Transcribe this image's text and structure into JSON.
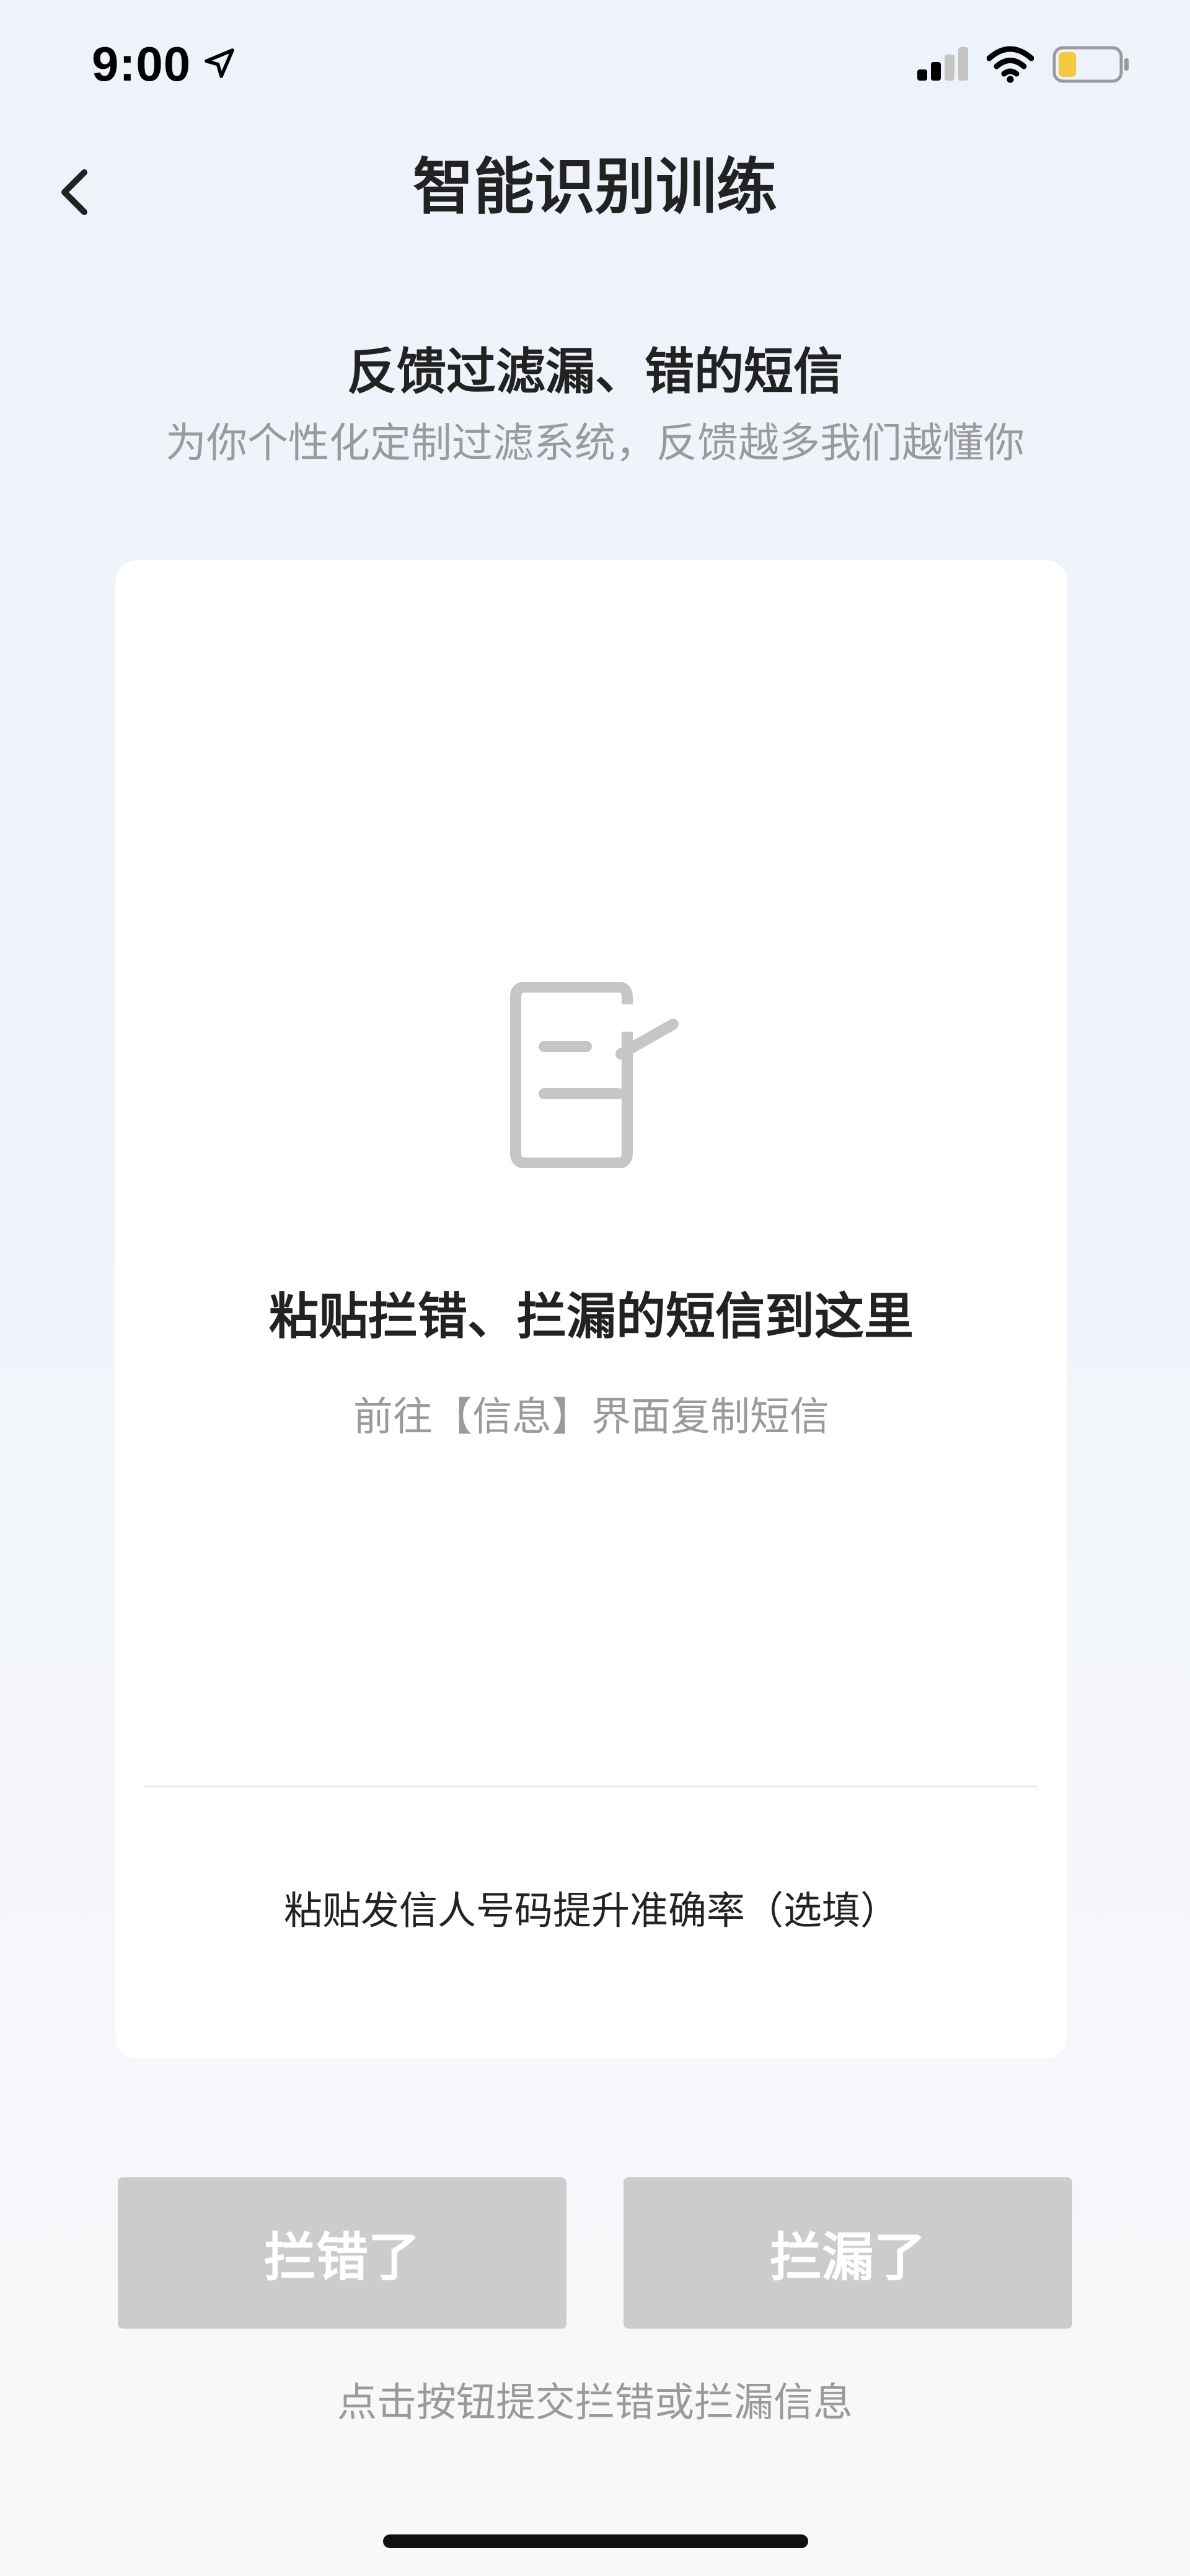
{
  "status_bar": {
    "time": "9:00",
    "icons": [
      "location-arrow-icon",
      "cellular-signal-icon",
      "wifi-icon",
      "battery-icon"
    ],
    "battery_level": 0.3,
    "battery_color": "#f5c842"
  },
  "nav": {
    "back_icon": "chevron-left-icon",
    "title": "智能识别训练"
  },
  "header": {
    "title": "反馈过滤漏、错的短信",
    "subtitle": "为你个性化定制过滤系统，反馈越多我们越懂你"
  },
  "card": {
    "icon": "note-edit-icon",
    "paste_title": "粘贴拦错、拦漏的短信到这里",
    "paste_hint": "前往【信息】界面复制短信",
    "sender_placeholder": "粘贴发信人号码提升准确率（选填）",
    "sender_value": ""
  },
  "actions": {
    "wrong_label": "拦错了",
    "missed_label": "拦漏了",
    "disabled_color": "#cccccc"
  },
  "footer": {
    "hint": "点击按钮提交拦错或拦漏信息"
  }
}
